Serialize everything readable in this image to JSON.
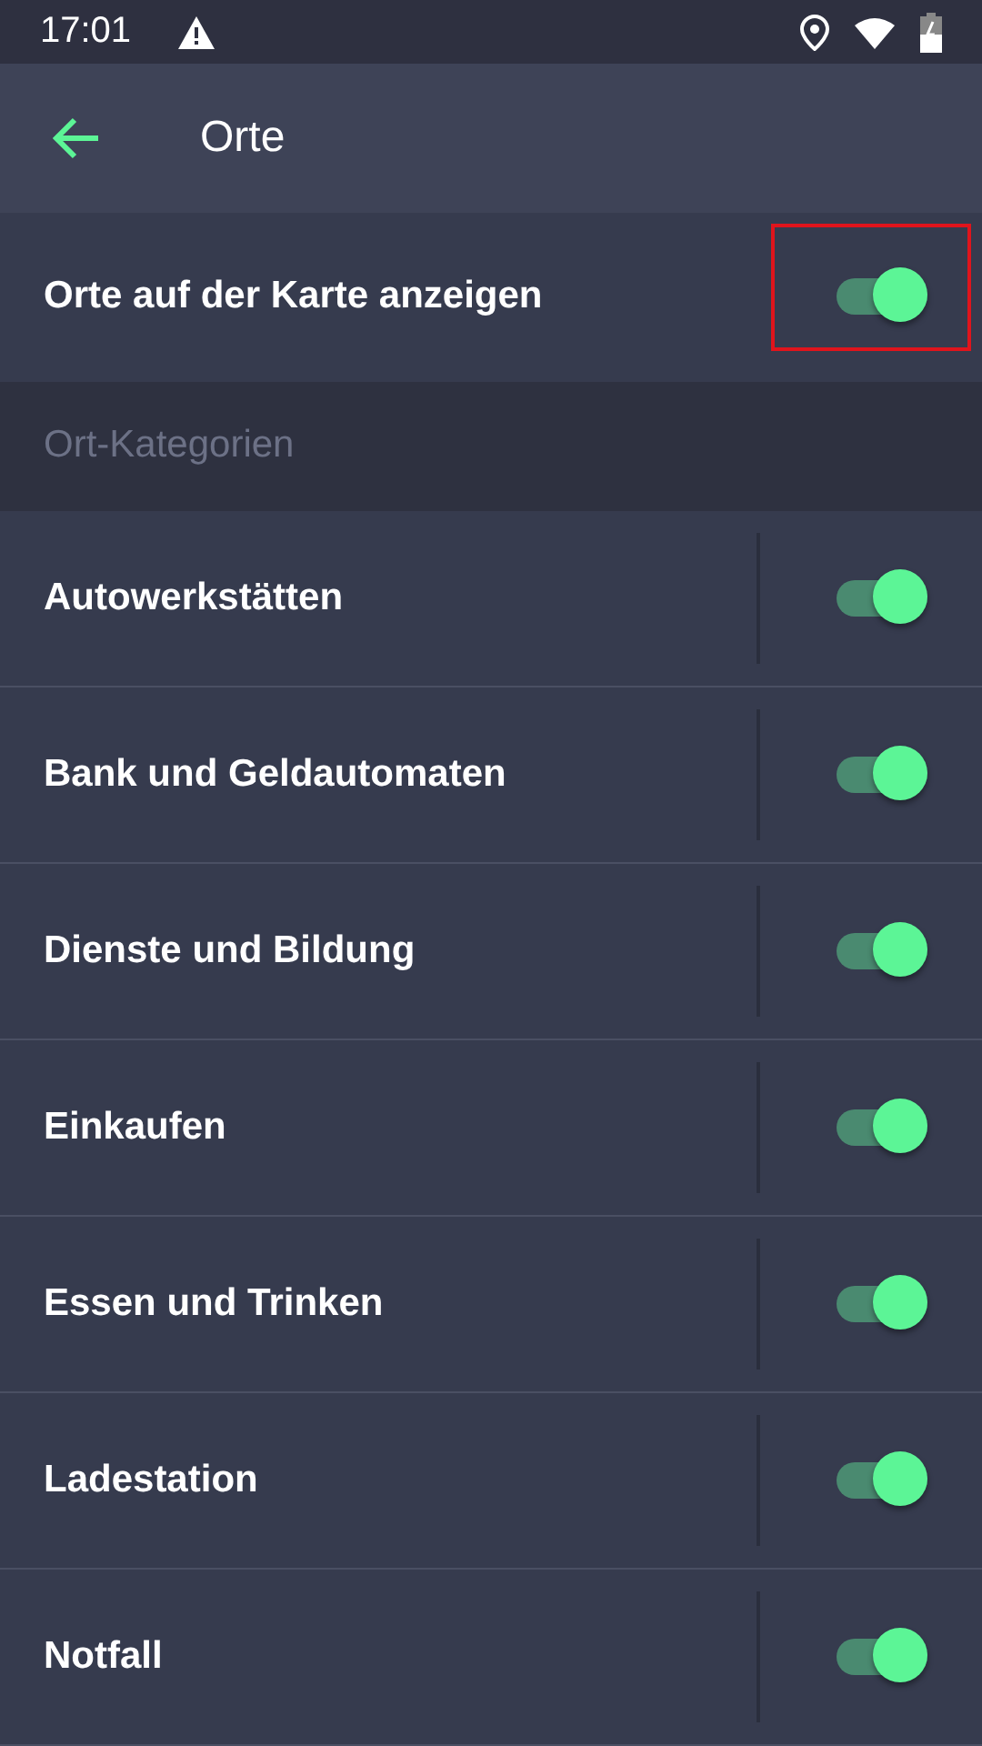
{
  "status_bar": {
    "time": "17:01"
  },
  "header": {
    "title": "Orte"
  },
  "main_setting": {
    "label": "Orte auf der Karte anzeigen",
    "on": true,
    "highlighted": true
  },
  "section": {
    "title": "Ort-Kategorien"
  },
  "categories": [
    {
      "label": "Autowerkstätten",
      "on": true
    },
    {
      "label": "Bank und Geldautomaten",
      "on": true
    },
    {
      "label": "Dienste und Bildung",
      "on": true
    },
    {
      "label": "Einkaufen",
      "on": true
    },
    {
      "label": "Essen und Trinken",
      "on": true
    },
    {
      "label": "Ladestation",
      "on": true
    },
    {
      "label": "Notfall",
      "on": true
    }
  ]
}
